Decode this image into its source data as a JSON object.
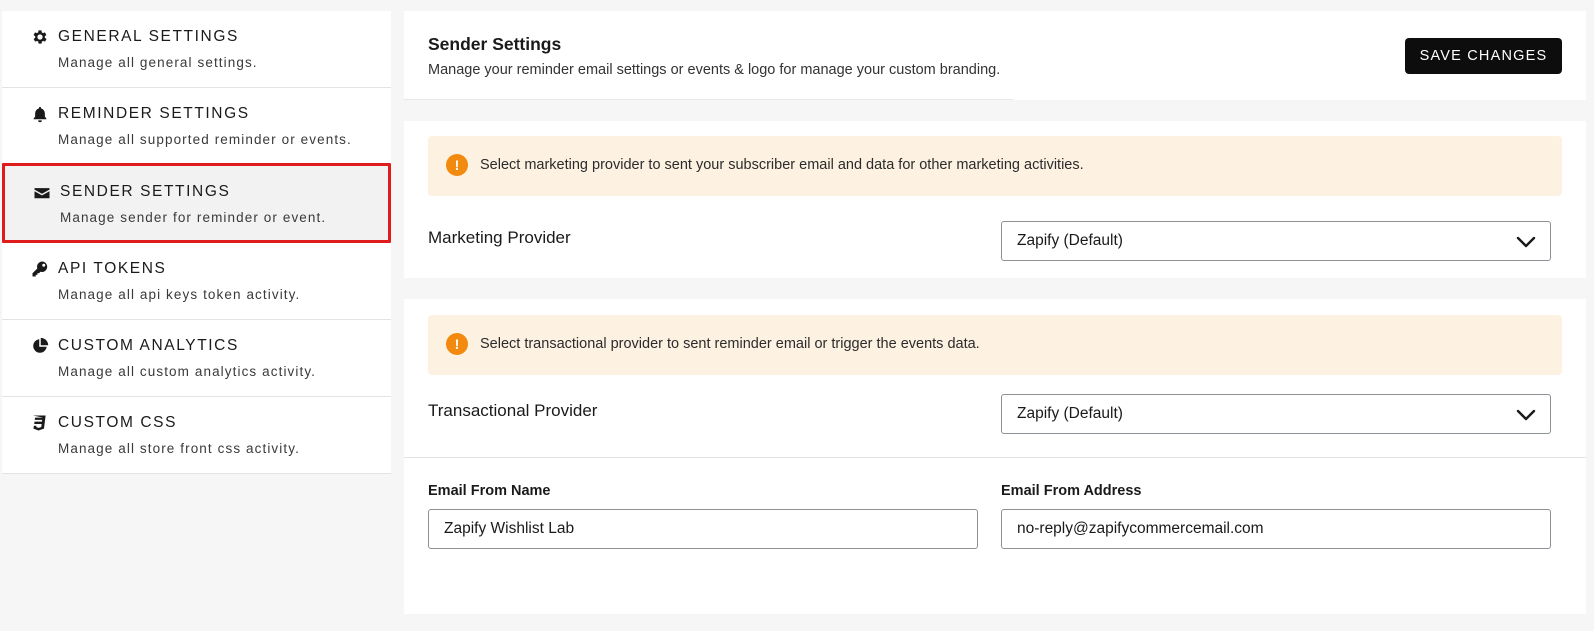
{
  "sidebar": {
    "items": [
      {
        "title": "GENERAL SETTINGS",
        "desc": "Manage all general settings.",
        "icon": "gear-icon"
      },
      {
        "title": "REMINDER SETTINGS",
        "desc": "Manage all supported reminder or events.",
        "icon": "bell-icon"
      },
      {
        "title": "SENDER SETTINGS",
        "desc": "Manage sender for reminder or event.",
        "icon": "envelope-icon"
      },
      {
        "title": "API TOKENS",
        "desc": "Manage all api keys token activity.",
        "icon": "key-icon"
      },
      {
        "title": "CUSTOM ANALYTICS",
        "desc": "Manage all custom analytics activity.",
        "icon": "pie-chart-icon"
      },
      {
        "title": "CUSTOM CSS",
        "desc": "Manage all store front css activity.",
        "icon": "css3-icon"
      }
    ],
    "active_index": 2,
    "active_border_color": "#e01b1b"
  },
  "header": {
    "title": "Sender Settings",
    "subtitle": "Manage your reminder email settings or events & logo for manage your custom branding.",
    "save_label": "SAVE CHANGES"
  },
  "marketing": {
    "banner": "Select marketing provider to sent your subscriber email and data for other marketing activities.",
    "label": "Marketing Provider",
    "selected": "Zapify (Default)"
  },
  "transactional": {
    "banner": "Select transactional provider to sent reminder email or trigger the events data.",
    "label": "Transactional Provider",
    "selected": "Zapify (Default)"
  },
  "email": {
    "from_name_label": "Email From Name",
    "from_name_value": "Zapify Wishlist Lab",
    "from_address_label": "Email From Address",
    "from_address_value": "no-reply@zapifycommercemail.com"
  },
  "colors": {
    "warning_icon": "#f28a0f",
    "banner_bg": "#fdf1e2",
    "button_bg": "#0d0d0d"
  }
}
